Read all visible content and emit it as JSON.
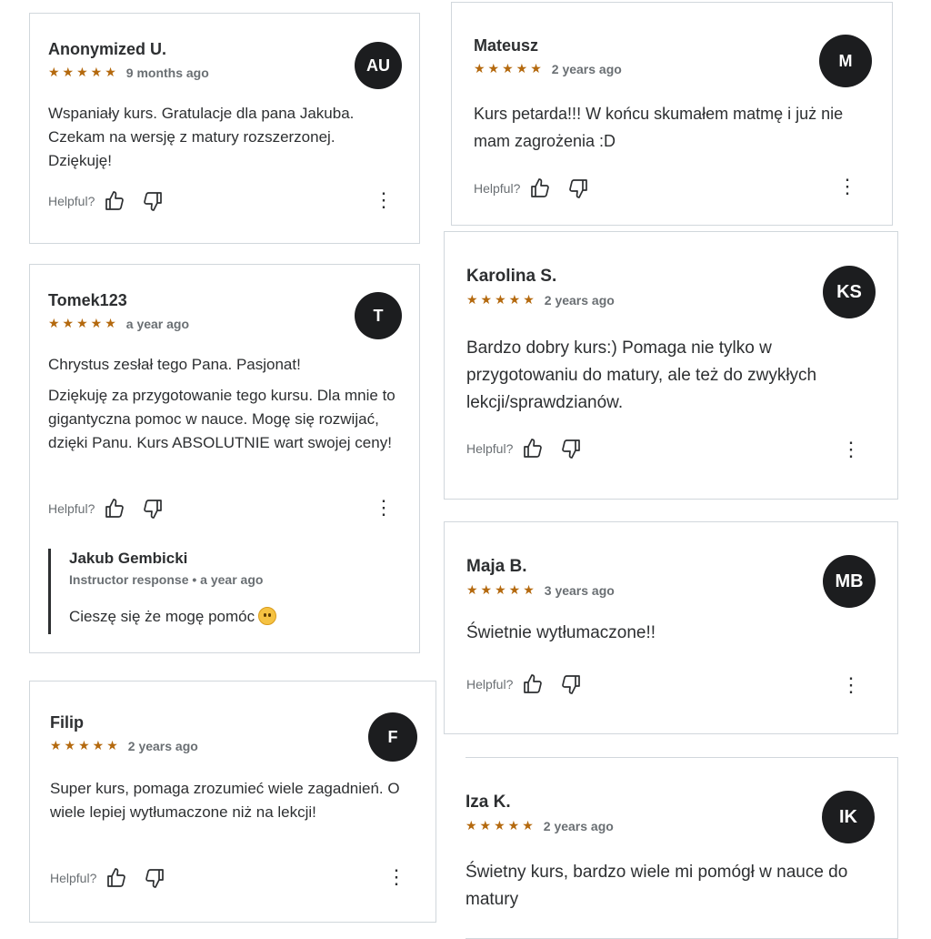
{
  "helpful_label": "Helpful?",
  "stars": "★★★★★",
  "reviews": [
    {
      "name": "Anonymized U.",
      "when": "9 months ago",
      "initials": "AU",
      "text": [
        "Wspaniały kurs. Gratulacje dla pana Jakuba. Czekam na wersję z matury rozszerzonej. Dziękuję!"
      ]
    },
    {
      "name": "Mateusz",
      "when": "2 years ago",
      "initials": "M",
      "text": [
        "Kurs petarda!!! W końcu skumałem matmę i już nie mam zagrożenia :D"
      ]
    },
    {
      "name": "Tomek123",
      "when": "a year ago",
      "initials": "T",
      "text": [
        "Chrystus zesłał tego Pana. Pasjonat!",
        "Dziękuję za przygotowanie tego kursu. Dla mnie to gigantyczna pomoc w nauce. Mogę się rozwijać, dzięki Panu. Kurs ABSOLUTNIE wart swojej ceny!"
      ],
      "reply": {
        "name": "Jakub Gembicki",
        "role": "Instructor response",
        "sep": "•",
        "when": "a year ago",
        "text": "Cieszę się że mogę pomóc"
      }
    },
    {
      "name": "Karolina S.",
      "when": "2 years ago",
      "initials": "KS",
      "text": [
        "Bardzo dobry kurs:) Pomaga nie tylko w przygotowaniu do matury, ale też do zwykłych lekcji/sprawdzianów."
      ]
    },
    {
      "name": "Maja B.",
      "when": "3 years ago",
      "initials": "MB",
      "text": [
        "Świetnie wytłumaczone!!"
      ]
    },
    {
      "name": "Filip",
      "when": "2 years ago",
      "initials": "F",
      "text": [
        "Super kurs, pomaga zrozumieć wiele zagadnień. O wiele lepiej wytłumaczone niż na lekcji!"
      ]
    },
    {
      "name": "Iza K.",
      "when": "2 years ago",
      "initials": "IK",
      "text": [
        "Świetny kurs, bardzo wiele mi pomógł w nauce do matury"
      ]
    }
  ]
}
